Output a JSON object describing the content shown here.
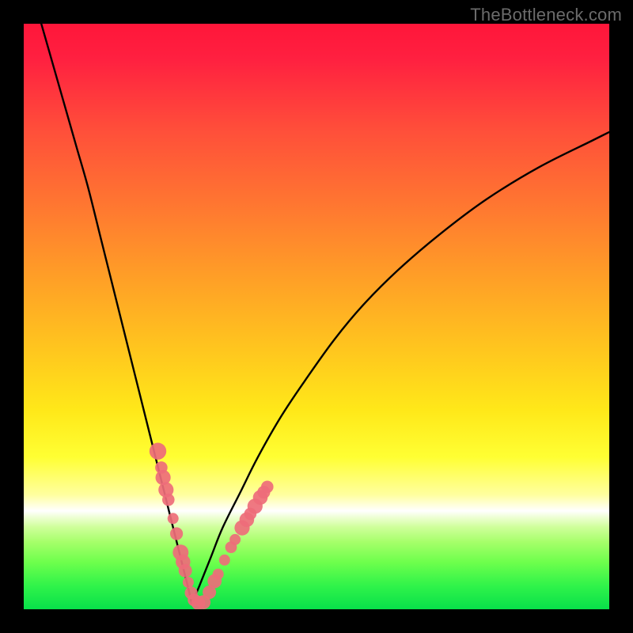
{
  "watermark": "TheBottleneck.com",
  "colors": {
    "frame_bg": "#000000",
    "curve_stroke": "#000000",
    "marker_fill": "#ee6d7a",
    "marker_fill_alt": "#ef7d88"
  },
  "chart_data": {
    "type": "line",
    "title": "",
    "xlabel": "",
    "ylabel": "",
    "xlim": [
      0,
      100
    ],
    "ylim": [
      0,
      100
    ],
    "axes_visible": false,
    "legend": false,
    "notes": "V-shaped bottleneck curve over rainbow gradient background. X roughly represents component balance; Y represents bottleneck percentage (top = 100%, bottom = 0%). No tick labels are rendered in the image, so values are geometric estimates.",
    "series": [
      {
        "name": "left-arm",
        "x": [
          3,
          5,
          7,
          9,
          11,
          13,
          15,
          17,
          19,
          21,
          23,
          24.5,
          26,
          27,
          28,
          28.7
        ],
        "y": [
          100,
          93,
          86,
          79,
          72,
          64,
          56,
          48,
          40,
          32,
          24,
          18,
          12,
          8,
          4,
          1
        ]
      },
      {
        "name": "right-arm",
        "x": [
          28.7,
          30,
          32,
          34,
          37,
          40,
          44,
          48,
          53,
          58,
          64,
          71,
          79,
          88,
          97,
          100
        ],
        "y": [
          1,
          4,
          9,
          14,
          20,
          26,
          33,
          39,
          46,
          52,
          58,
          64,
          70,
          75.5,
          80,
          81.5
        ]
      }
    ],
    "markers": [
      {
        "x": 22.9,
        "y": 27.0,
        "r": 1.45
      },
      {
        "x": 23.5,
        "y": 24.2,
        "r": 1.05
      },
      {
        "x": 23.8,
        "y": 22.5,
        "r": 1.3
      },
      {
        "x": 24.3,
        "y": 20.4,
        "r": 1.3
      },
      {
        "x": 24.7,
        "y": 18.7,
        "r": 1.05
      },
      {
        "x": 25.5,
        "y": 15.5,
        "r": 0.95
      },
      {
        "x": 26.1,
        "y": 12.9,
        "r": 1.1
      },
      {
        "x": 26.8,
        "y": 9.7,
        "r": 1.35
      },
      {
        "x": 27.2,
        "y": 8.1,
        "r": 1.25
      },
      {
        "x": 27.6,
        "y": 6.6,
        "r": 1.15
      },
      {
        "x": 28.1,
        "y": 4.6,
        "r": 0.95
      },
      {
        "x": 28.6,
        "y": 2.8,
        "r": 1.1
      },
      {
        "x": 29.1,
        "y": 1.6,
        "r": 1.1
      },
      {
        "x": 29.8,
        "y": 1.1,
        "r": 1.2
      },
      {
        "x": 30.7,
        "y": 1.2,
        "r": 1.2
      },
      {
        "x": 31.7,
        "y": 2.9,
        "r": 1.15
      },
      {
        "x": 32.6,
        "y": 4.8,
        "r": 1.2
      },
      {
        "x": 33.2,
        "y": 6.0,
        "r": 0.95
      },
      {
        "x": 34.3,
        "y": 8.4,
        "r": 0.95
      },
      {
        "x": 35.4,
        "y": 10.6,
        "r": 1.0
      },
      {
        "x": 36.1,
        "y": 11.9,
        "r": 0.95
      },
      {
        "x": 37.3,
        "y": 13.9,
        "r": 1.3
      },
      {
        "x": 38.1,
        "y": 15.3,
        "r": 1.25
      },
      {
        "x": 38.7,
        "y": 16.3,
        "r": 1.05
      },
      {
        "x": 39.5,
        "y": 17.6,
        "r": 1.3
      },
      {
        "x": 40.4,
        "y": 19.1,
        "r": 1.25
      },
      {
        "x": 41.0,
        "y": 20.0,
        "r": 1.1
      },
      {
        "x": 41.6,
        "y": 20.9,
        "r": 1.05
      }
    ]
  }
}
